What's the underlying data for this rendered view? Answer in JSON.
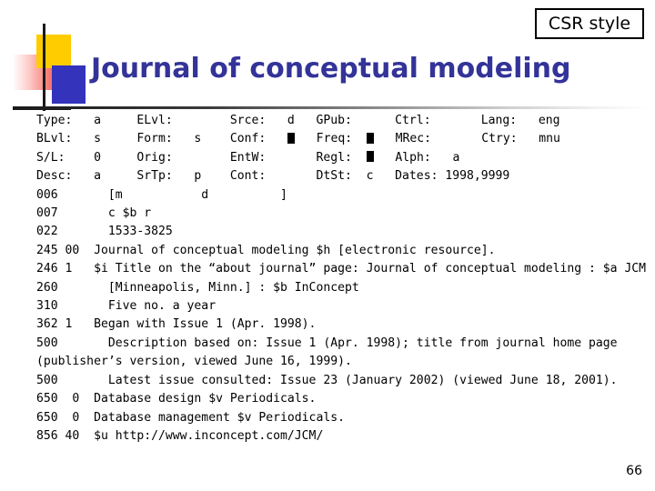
{
  "badge": {
    "label": "CSR style"
  },
  "slide": {
    "title": "Journal of conceptual modeling",
    "title_color": "#333399",
    "page_number": "66"
  },
  "logo": {
    "yellow_color": "#FFCC00",
    "blue_color": "#3333BB",
    "red_color": "#F03A33",
    "line_color": "#1A1A1A"
  },
  "record": {
    "fixed_fields": [
      {
        "line_index": 0,
        "cells": [
          {
            "label": "Type:",
            "value": "a"
          },
          {
            "label": "ELvl:",
            "value": ""
          },
          {
            "label": "Srce:",
            "value": "d"
          },
          {
            "label": "GPub:",
            "value": ""
          },
          {
            "label": "Ctrl:",
            "value": ""
          },
          {
            "label": "Lang:",
            "value": "eng"
          }
        ]
      },
      {
        "line_index": 1,
        "cells": [
          {
            "label": "BLvl:",
            "value": "s"
          },
          {
            "label": "Form:",
            "value": "s"
          },
          {
            "label": "Conf:",
            "value": "■"
          },
          {
            "label": "Freq:",
            "value": "■"
          },
          {
            "label": "MRec:",
            "value": ""
          },
          {
            "label": "Ctry:",
            "value": "mnu"
          }
        ]
      },
      {
        "line_index": 2,
        "cells": [
          {
            "label": "S/L:",
            "value": "0"
          },
          {
            "label": "Orig:",
            "value": ""
          },
          {
            "label": "EntW:",
            "value": ""
          },
          {
            "label": "Regl:",
            "value": "■"
          },
          {
            "label": "Alph:",
            "value": "a"
          },
          {
            "label": "",
            "value": ""
          }
        ]
      },
      {
        "line_index": 3,
        "cells": [
          {
            "label": "Desc:",
            "value": "a"
          },
          {
            "label": "SrTp:",
            "value": "p"
          },
          {
            "label": "Cont:",
            "value": ""
          },
          {
            "label": "DtSt:",
            "value": "c"
          },
          {
            "label": "Dates:",
            "value": "1998,9999"
          },
          {
            "label": "",
            "value": ""
          }
        ]
      }
    ],
    "lines": [
      "Type:   a     ELvl:        Srce:   d   GPub:      Ctrl:       Lang:   eng",
      "BLvl:   s     Form:   s    Conf:   ■   Freq:  ■   MRec:       Ctry:   mnu",
      "S/L:    0     Orig:        EntW:       Regl:  ■   Alph:   a",
      "Desc:   a     SrTp:   p    Cont:       DtSt:  c   Dates: 1998,9999",
      "006       [m           d          ]",
      "007       c $b r",
      "022       1533-3825",
      "245 00  Journal of conceptual modeling $h [electronic resource].",
      "246 1   $i Title on the “about journal” page: Journal of conceptual modeling : $a JCM",
      "260       [Minneapolis, Minn.] : $b InConcept",
      "310       Five no. a year",
      "362 1   Began with Issue 1 (Apr. 1998).",
      "500       Description based on: Issue 1 (Apr. 1998); title from journal home page (publisher’s version, viewed June 16, 1999).",
      "500       Latest issue consulted: Issue 23 (January 2002) (viewed June 18, 2001).",
      "650  0  Database design $v Periodicals.",
      "650  0  Database management $v Periodicals.",
      "856 40  $u http://www.inconcept.com/JCM/"
    ],
    "marc_fields": [
      {
        "tag": "006",
        "indicators": "",
        "content": "[m           d          ]"
      },
      {
        "tag": "007",
        "indicators": "",
        "content": "c $b r"
      },
      {
        "tag": "022",
        "indicators": "",
        "content": "1533-3825"
      },
      {
        "tag": "245",
        "indicators": "00",
        "content": "Journal of conceptual modeling $h [electronic resource]."
      },
      {
        "tag": "246",
        "indicators": "1",
        "content": "$i Title on the “about journal” page: Journal of conceptual modeling : $a JCM"
      },
      {
        "tag": "260",
        "indicators": "",
        "content": "[Minneapolis, Minn.] : $b InConcept"
      },
      {
        "tag": "310",
        "indicators": "",
        "content": "Five no. a year"
      },
      {
        "tag": "362",
        "indicators": "1",
        "content": "Began with Issue 1 (Apr. 1998)."
      },
      {
        "tag": "500",
        "indicators": "",
        "content": "Description based on: Issue 1 (Apr. 1998); title from journal home page (publisher’s version, viewed June 16, 1999)."
      },
      {
        "tag": "500",
        "indicators": "",
        "content": "Latest issue consulted: Issue 23 (January 2002) (viewed June 18, 2001)."
      },
      {
        "tag": "650",
        "indicators": "0",
        "content": "Database design $v Periodicals."
      },
      {
        "tag": "650",
        "indicators": "0",
        "content": "Database management $v Periodicals."
      },
      {
        "tag": "856",
        "indicators": "40",
        "content": "$u http://www.inconcept.com/JCM/"
      }
    ]
  }
}
